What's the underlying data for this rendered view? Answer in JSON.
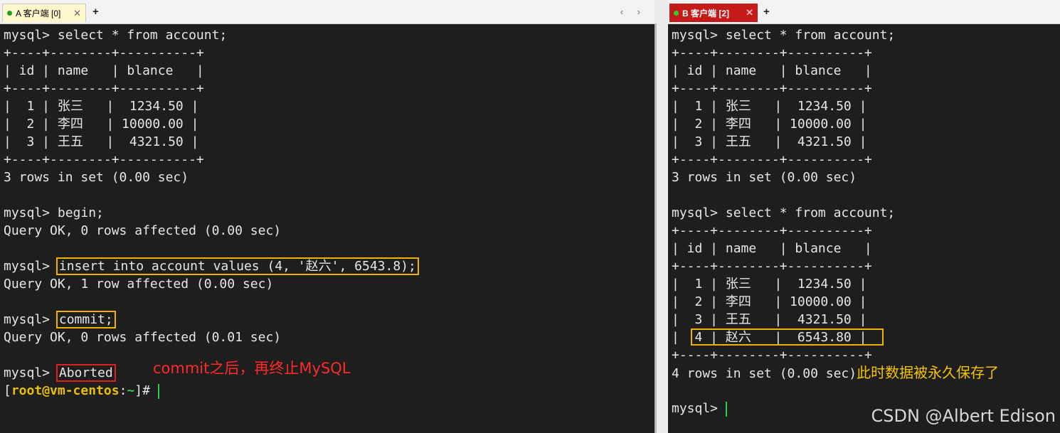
{
  "tabs": {
    "a": {
      "label": "A 客户端 [0]",
      "close": "✕"
    },
    "b": {
      "label": "B 客户端  [2]",
      "close": "✕"
    },
    "add": "+",
    "nav": "‹ ›"
  },
  "terminal_a": {
    "lines": [
      "mysql> select * from account;",
      "+----+--------+----------+",
      "| id | name   | blance   |",
      "+----+--------+----------+",
      "|  1 | 张三   |  1234.50 |",
      "|  2 | 李四   | 10000.00 |",
      "|  3 | 王五   |  4321.50 |",
      "+----+--------+----------+",
      "3 rows in set (0.00 sec)",
      "",
      "mysql> begin;",
      "Query OK, 0 rows affected (0.00 sec)",
      "",
      "Query OK, 1 row affected (0.00 sec)",
      "",
      "Query OK, 0 rows affected (0.01 sec)",
      ""
    ],
    "prompt": "mysql> ",
    "insert_cmd": "insert into account values (4, '赵六', 6543.8);",
    "commit_cmd": "commit;",
    "aborted": "Aborted",
    "annotation": "commit之后，再终止MySQL",
    "shell_open": "[",
    "shell_user": "root@vm-centos",
    "shell_colon": ":",
    "shell_tilde": "~",
    "shell_close": "]# "
  },
  "terminal_b": {
    "lines": [
      "mysql> select * from account;",
      "+----+--------+----------+",
      "| id | name   | blance   |",
      "+----+--------+----------+",
      "|  1 | 张三   |  1234.50 |",
      "|  2 | 李四   | 10000.00 |",
      "|  3 | 王五   |  4321.50 |",
      "+----+--------+----------+",
      "3 rows in set (0.00 sec)",
      "",
      "mysql> select * from account;",
      "+----+--------+----------+",
      "| id | name   | blance   |",
      "+----+--------+----------+",
      "|  1 | 张三   |  1234.50 |",
      "|  2 | 李四   | 10000.00 |",
      "|  3 | 王五   |  4321.50 |",
      "|  4 | 赵六   |  6543.80 |",
      "+----+--------+----------+"
    ],
    "rows_result": "4 rows in set (0.00 sec)",
    "annotation": "此时数据被永久保存了",
    "prompt": "mysql> "
  },
  "watermark": "CSDN @Albert Edison",
  "colors": {
    "highlight": "#f0b400",
    "alert": "#e02020",
    "cursor": "#2ecc40",
    "tab_b": "#c41a1a"
  }
}
